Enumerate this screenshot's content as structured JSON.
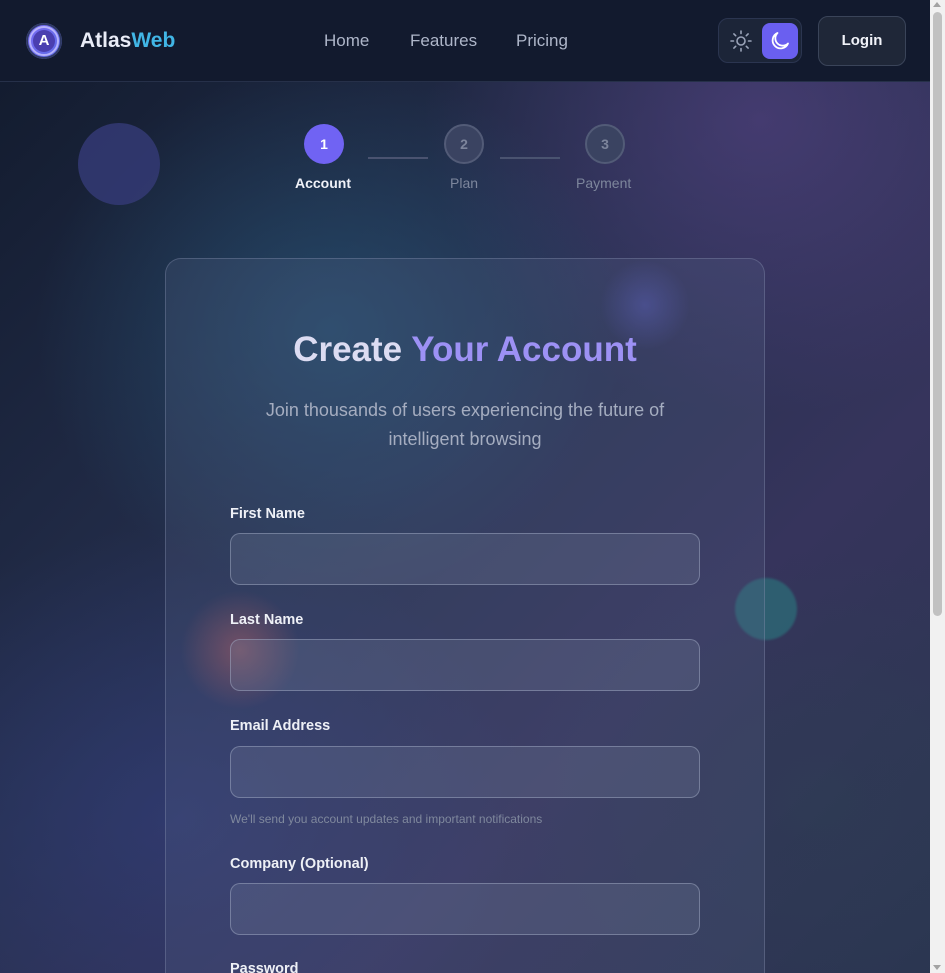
{
  "header": {
    "logo_letter": "A",
    "brand_part1": "Atlas",
    "brand_part2": "Web",
    "nav": [
      "Home",
      "Features",
      "Pricing"
    ],
    "theme": {
      "light_icon": "sun-icon",
      "dark_icon": "moon-icon",
      "active": "dark"
    },
    "login_label": "Login"
  },
  "stepper": {
    "steps": [
      {
        "number": "1",
        "label": "Account",
        "active": true
      },
      {
        "number": "2",
        "label": "Plan",
        "active": false
      },
      {
        "number": "3",
        "label": "Payment",
        "active": false
      }
    ]
  },
  "form": {
    "title_part1": "Create ",
    "title_part2": "Your Account",
    "subtitle": "Join thousands of users experiencing the future of intelligent browsing",
    "fields": [
      {
        "label": "First Name",
        "value": ""
      },
      {
        "label": "Last Name",
        "value": ""
      },
      {
        "label": "Email Address",
        "value": "",
        "helper": "We'll send you account updates and important notifications"
      },
      {
        "label": "Company (Optional)",
        "value": ""
      },
      {
        "label": "Password",
        "value": ""
      }
    ]
  },
  "colors": {
    "accent": "#7063f3",
    "brand_secondary": "#41b6e6",
    "header_bg": "#121a2e"
  }
}
